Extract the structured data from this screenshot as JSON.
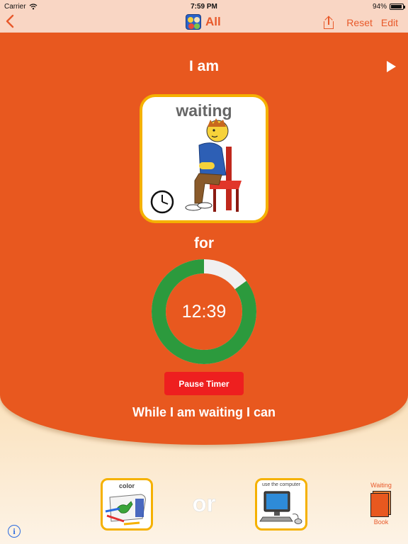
{
  "status_bar": {
    "carrier": "Carrier",
    "time": "7:59 PM",
    "battery": "94%"
  },
  "nav": {
    "title": "All",
    "reset_label": "Reset",
    "edit_label": "Edit"
  },
  "main": {
    "prefix": "I am",
    "activity_label": "waiting",
    "connector": "for",
    "timer": {
      "time": "12:39",
      "remaining_fraction": 0.85,
      "pause_label": "Pause Timer"
    },
    "suffix": "While I am waiting I can"
  },
  "choices": [
    {
      "label": "color"
    },
    {
      "label": "use the computer"
    }
  ],
  "or_label": "or",
  "book": {
    "top_label": "Waiting",
    "bottom_label": "Book"
  },
  "colors": {
    "accent": "#e8592a",
    "panel": "#e8581f",
    "ring_fill": "#2c9a3d",
    "ring_track": "#f0f0f0",
    "pause_button": "#ee1f1f",
    "card_border": "#f5b100"
  },
  "icons": [
    "back-chevron-icon",
    "app-logo-icon",
    "share-icon",
    "play-icon",
    "clock-icon",
    "info-icon",
    "book-icon"
  ]
}
